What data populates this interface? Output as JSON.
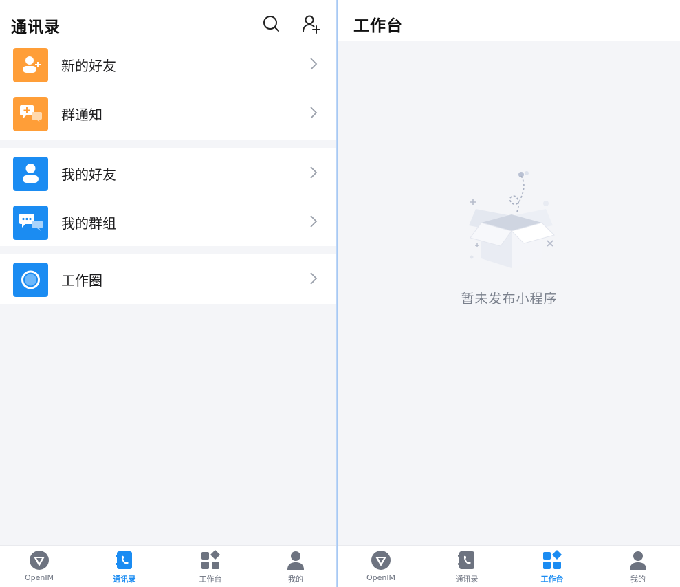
{
  "contacts": {
    "title": "通讯录",
    "rows_group1": [
      {
        "label": "新的好友",
        "icon": "add-friend-icon"
      },
      {
        "label": "群通知",
        "icon": "group-notice-icon"
      }
    ],
    "rows_group2": [
      {
        "label": "我的好友",
        "icon": "friend-icon"
      },
      {
        "label": "我的群组",
        "icon": "group-chat-icon"
      }
    ],
    "rows_group3": [
      {
        "label": "工作圈",
        "icon": "moments-icon"
      }
    ]
  },
  "workbench": {
    "title": "工作台",
    "empty_text": "暂未发布小程序"
  },
  "tabs": [
    {
      "label": "OpenIM",
      "icon": "openim-logo-icon"
    },
    {
      "label": "通讯录",
      "icon": "contacts-book-icon"
    },
    {
      "label": "工作台",
      "icon": "workbench-grid-icon"
    },
    {
      "label": "我的",
      "icon": "profile-person-icon"
    }
  ],
  "colors": {
    "accent": "#1b8cf2",
    "orange": "#ff9e38",
    "tab_inactive": "#6d7380",
    "background": "#f4f5f8"
  }
}
